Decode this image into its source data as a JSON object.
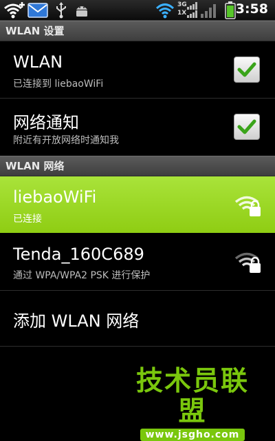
{
  "status_bar": {
    "time": "3:58",
    "network_3g": "3G",
    "network_1x": "1X",
    "icons": [
      "wifi-add-icon",
      "email-icon",
      "usb-icon",
      "android-debug-icon",
      "wifi-icon",
      "signal-3g-icon",
      "signal-1x-icon",
      "signal-bars-icon",
      "battery-icon"
    ]
  },
  "sections": {
    "settings_header": "WLAN 设置",
    "networks_header": "WLAN 网络"
  },
  "settings": [
    {
      "title": "WLAN",
      "subtitle": "已连接到 liebaoWiFi",
      "checked": true
    },
    {
      "title": "网络通知",
      "subtitle": "附近有开放网络时通知我",
      "checked": true
    }
  ],
  "networks": [
    {
      "ssid": "liebaoWiFi",
      "status": "已连接",
      "secured": true,
      "selected": true
    },
    {
      "ssid": "Tenda_160C689",
      "status": "通过 WPA/WPA2 PSK 进行保护",
      "secured": true,
      "selected": false
    }
  ],
  "add_network_label": "添加 WLAN 网络",
  "watermark": {
    "title": "技术员联盟",
    "url": "www.jsgho.com"
  },
  "colors": {
    "accent_green": "#9ad92a",
    "watermark_green": "#7ac70d",
    "check_green": "#3aa41a"
  }
}
